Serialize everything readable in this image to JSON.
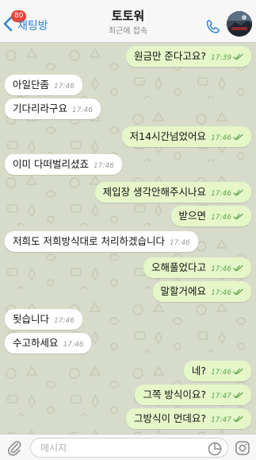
{
  "header": {
    "back_label": "채팅방",
    "unread_count": "80",
    "title": "토토워",
    "status": "최근에 접속"
  },
  "messages": [
    {
      "dir": "out",
      "text": "원금만 준다고요?",
      "time": "17:39",
      "read": true
    },
    {
      "dir": "in",
      "text": "아일단좀",
      "time": "17:46"
    },
    {
      "dir": "in",
      "text": "기다리라구요",
      "time": "17:46"
    },
    {
      "dir": "out",
      "text": "저14시간넘었어요",
      "time": "17:46",
      "read": true
    },
    {
      "dir": "in",
      "text": "이미 다떠벌리셨죠",
      "time": "17:46"
    },
    {
      "dir": "out",
      "text": "제입장 생각안해주시나요",
      "time": "17:46",
      "read": true
    },
    {
      "dir": "out",
      "text": "받으면",
      "time": "17:46",
      "read": true
    },
    {
      "dir": "in",
      "text": "저희도 저희방식대로 처리하겠습니다",
      "time": "17:46"
    },
    {
      "dir": "out",
      "text": "오해풀었다고",
      "time": "17:46",
      "read": true
    },
    {
      "dir": "out",
      "text": "말할거에요",
      "time": "17:46",
      "read": true
    },
    {
      "dir": "in",
      "text": "됫습니다",
      "time": "17:46"
    },
    {
      "dir": "in",
      "text": "수고하세요",
      "time": "17:46"
    },
    {
      "dir": "out",
      "text": "네?",
      "time": "17:46",
      "read": true
    },
    {
      "dir": "out",
      "text": "그쪽 방식이요?",
      "time": "17:47",
      "read": true
    },
    {
      "dir": "out",
      "text": "그방식이 먼데요?",
      "time": "17:47",
      "read": true
    }
  ],
  "composer": {
    "placeholder": "메시지"
  },
  "icons": {
    "back": "chevron-left-icon",
    "call": "phone-icon",
    "attach": "paperclip-icon",
    "sticker": "sticker-icon",
    "camera": "camera-icon",
    "read_receipt": "double-check-icon"
  },
  "colors": {
    "chat_background": "#d7dbc9",
    "incoming_bubble": "#ffffff",
    "outgoing_bubble": "#e5f7c9",
    "accent": "#2a84d6",
    "badge": "#e8443a",
    "outgoing_meta": "#5fa84a"
  }
}
